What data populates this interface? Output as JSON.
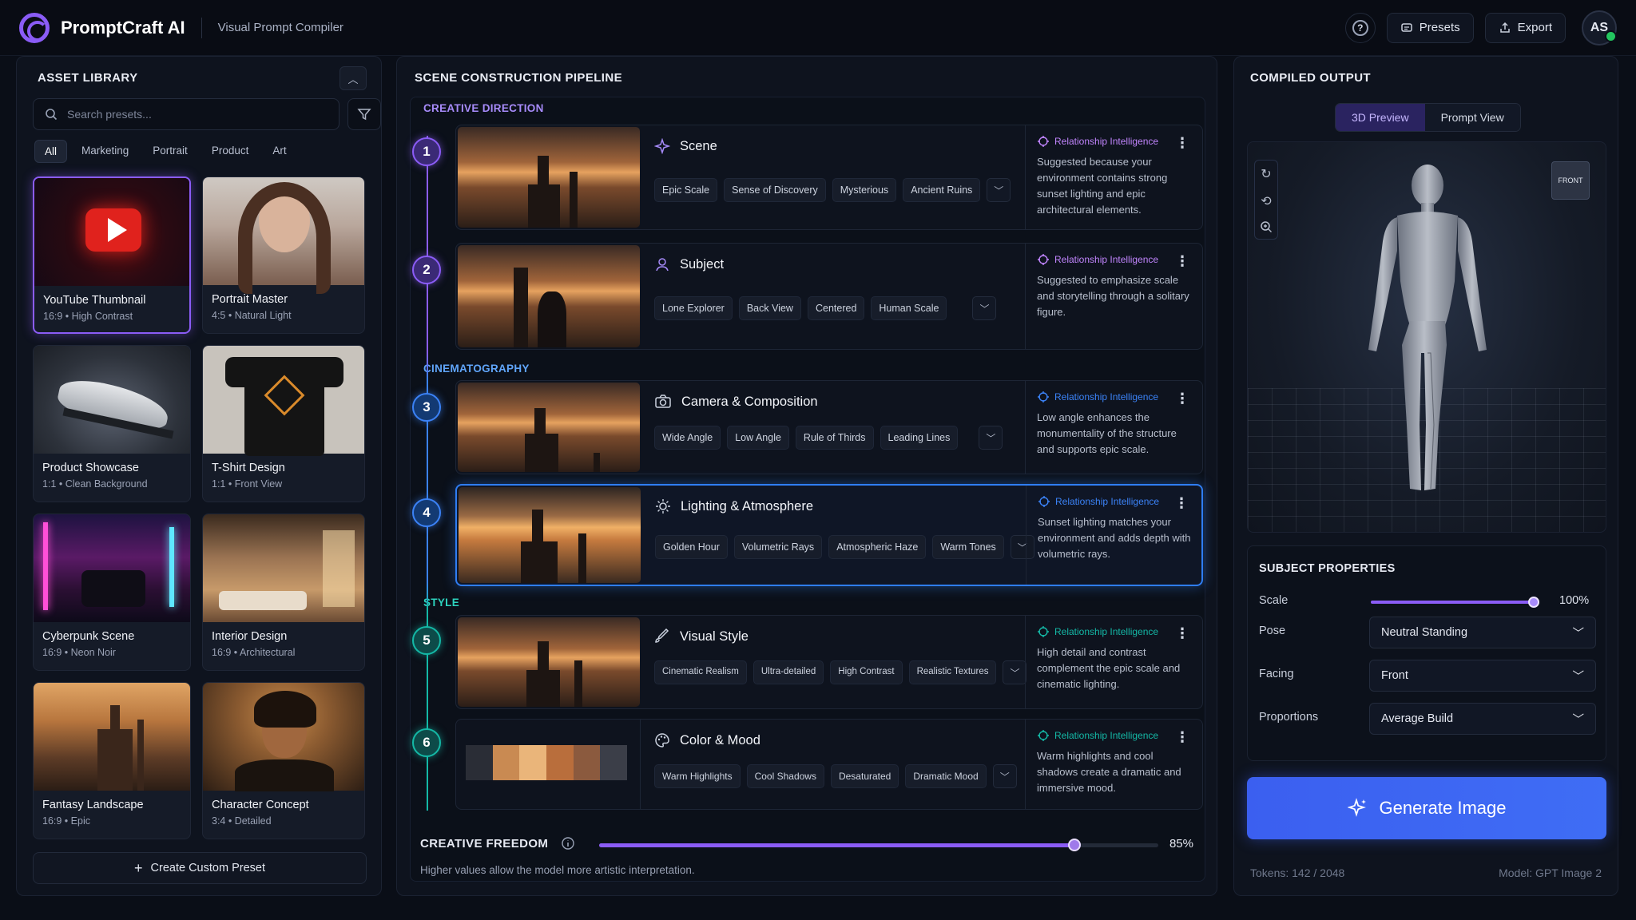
{
  "header": {
    "app_title": "PromptCraft AI",
    "subtitle": "Visual Prompt Compiler",
    "presets_label": "Presets",
    "export_label": "Export",
    "help_glyph": "?",
    "avatar_initials": "AS"
  },
  "library": {
    "title": "ASSET LIBRARY",
    "search_placeholder": "Search presets...",
    "filters": [
      "All",
      "Marketing",
      "Portrait",
      "Product",
      "Art"
    ],
    "active_filter": "All",
    "cards": [
      {
        "title": "YouTube Thumbnail",
        "meta": "16:9  •  High Contrast"
      },
      {
        "title": "Portrait Master",
        "meta": "4:5  •  Natural Light"
      },
      {
        "title": "Product Showcase",
        "meta": "1:1  •  Clean Background"
      },
      {
        "title": "T-Shirt Design",
        "meta": "1:1  •  Front View"
      },
      {
        "title": "Cyberpunk Scene",
        "meta": "16:9  •  Neon Noir"
      },
      {
        "title": "Interior Design",
        "meta": "16:9  •  Architectural"
      },
      {
        "title": "Fantasy Landscape",
        "meta": "16:9  •  Epic"
      },
      {
        "title": "Character Concept",
        "meta": "3:4  •  Detailed"
      }
    ],
    "create_label": "Create Custom Preset"
  },
  "pipeline": {
    "title": "SCENE CONSTRUCTION PIPELINE",
    "sections": {
      "creative": "CREATIVE DIRECTION",
      "cinema": "CINEMATOGRAPHY",
      "style": "STYLE"
    },
    "ri_label": "Relationship Intelligence",
    "steps": [
      {
        "num": "1",
        "title": "Scene",
        "tags": [
          "Epic Scale",
          "Sense of Discovery",
          "Mysterious",
          "Ancient Ruins"
        ],
        "ri": "Suggested because your environment contains strong sunset lighting and epic architectural elements."
      },
      {
        "num": "2",
        "title": "Subject",
        "tags": [
          "Lone Explorer",
          "Back View",
          "Centered",
          "Human Scale"
        ],
        "ri": "Suggested to emphasize scale and storytelling through a solitary figure."
      },
      {
        "num": "3",
        "title": "Camera & Composition",
        "tags": [
          "Wide Angle",
          "Low Angle",
          "Rule of Thirds",
          "Leading Lines"
        ],
        "ri": "Low angle enhances the monumentality of the structure and supports epic scale."
      },
      {
        "num": "4",
        "title": "Lighting & Atmosphere",
        "tags": [
          "Golden Hour",
          "Volumetric Rays",
          "Atmospheric Haze",
          "Warm Tones"
        ],
        "ri": "Sunset lighting matches your environment and adds depth with volumetric rays."
      },
      {
        "num": "5",
        "title": "Visual Style",
        "tags": [
          "Cinematic Realism",
          "Ultra-detailed",
          "High Contrast",
          "Realistic Textures"
        ],
        "ri": "High detail and contrast complement the epic scale and cinematic lighting."
      },
      {
        "num": "6",
        "title": "Color & Mood",
        "tags": [
          "Warm Highlights",
          "Cool Shadows",
          "Desaturated",
          "Dramatic Mood"
        ],
        "ri": "Warm highlights and cool shadows create a dramatic and immersive mood."
      }
    ],
    "palette": [
      "#2a2d36",
      "#c98a52",
      "#eab57a",
      "#b96e3c",
      "#8b5a3e",
      "#3b3e48"
    ],
    "colors": {
      "purple": "#8b5cf6",
      "blue": "#3b82f6",
      "teal": "#14b8a6"
    },
    "creative_freedom": {
      "label": "CREATIVE FREEDOM",
      "value": 0.85,
      "value_text": "85%",
      "description": "Higher values allow the model more artistic interpretation."
    }
  },
  "output": {
    "title": "COMPILED OUTPUT",
    "tabs": [
      "3D Preview",
      "Prompt View"
    ],
    "active_tab": "3D Preview",
    "front_label": "FRONT",
    "props_title": "SUBJECT PROPERTIES",
    "scale_label": "Scale",
    "scale_value": 1.0,
    "scale_text": "100%",
    "pose_label": "Pose",
    "pose_value": "Neutral Standing",
    "facing_label": "Facing",
    "facing_value": "Front",
    "proportions_label": "Proportions",
    "proportions_value": "Average Build",
    "generate_label": "Generate Image",
    "tokens": "Tokens: 142 / 2048",
    "model": "Model: GPT Image 2"
  }
}
